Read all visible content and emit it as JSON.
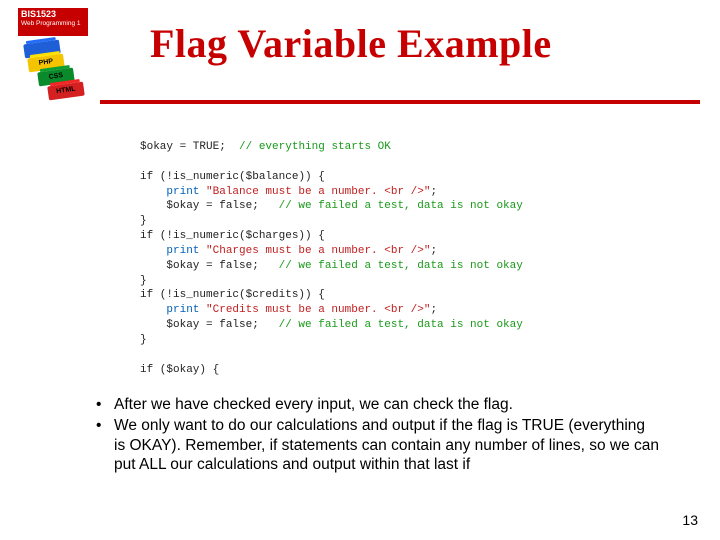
{
  "header": {
    "course_code": "BIS1523",
    "course_name": "Web Programming 1",
    "title": "Flag Variable Example",
    "bricks": {
      "blue": "",
      "yellow": "PHP",
      "green": "CSS",
      "red": "HTML"
    }
  },
  "code_lines": [
    [
      [
        "",
        ""
      ],
      [
        "$okay = TRUE;  ",
        ""
      ],
      [
        "// everything starts OK",
        "cm"
      ]
    ],
    [
      [
        "",
        ""
      ]
    ],
    [
      [
        "if",
        ""
      ],
      [
        " (!",
        ""
      ],
      [
        "is_numeric",
        ""
      ],
      [
        "($balance)) {",
        ""
      ]
    ],
    [
      [
        "    ",
        ""
      ],
      [
        "print ",
        "kw"
      ],
      [
        "\"Balance must be a number. <br />\"",
        "str"
      ],
      [
        ";",
        ""
      ]
    ],
    [
      [
        "    $okay = false;   ",
        ""
      ],
      [
        "// we failed a test, data is not okay",
        "cm"
      ]
    ],
    [
      [
        "}",
        ""
      ]
    ],
    [
      [
        "if (!is_numeric($charges)) {",
        ""
      ]
    ],
    [
      [
        "    ",
        ""
      ],
      [
        "print ",
        "kw"
      ],
      [
        "\"Charges must be a number. <br />\"",
        "str"
      ],
      [
        ";",
        ""
      ]
    ],
    [
      [
        "    $okay = false;   ",
        ""
      ],
      [
        "// we failed a test, data is not okay",
        "cm"
      ]
    ],
    [
      [
        "}",
        ""
      ]
    ],
    [
      [
        "if (!is_numeric($credits)) {",
        ""
      ]
    ],
    [
      [
        "    ",
        ""
      ],
      [
        "print ",
        "kw"
      ],
      [
        "\"Credits must be a number. <br />\"",
        "str"
      ],
      [
        ";",
        ""
      ]
    ],
    [
      [
        "    $okay = false;   ",
        ""
      ],
      [
        "// we failed a test, data is not okay",
        "cm"
      ]
    ],
    [
      [
        "}",
        ""
      ]
    ],
    [
      [
        "",
        ""
      ]
    ],
    [
      [
        "if ($okay) {",
        ""
      ]
    ]
  ],
  "bullets": [
    "After we have checked every input, we can check the flag.",
    "We only want to do our calculations and output if the flag is TRUE (everything is OKAY).  Remember, if statements can contain any number of lines, so we can put ALL our calculations and output within that last if"
  ],
  "page_number": "13"
}
